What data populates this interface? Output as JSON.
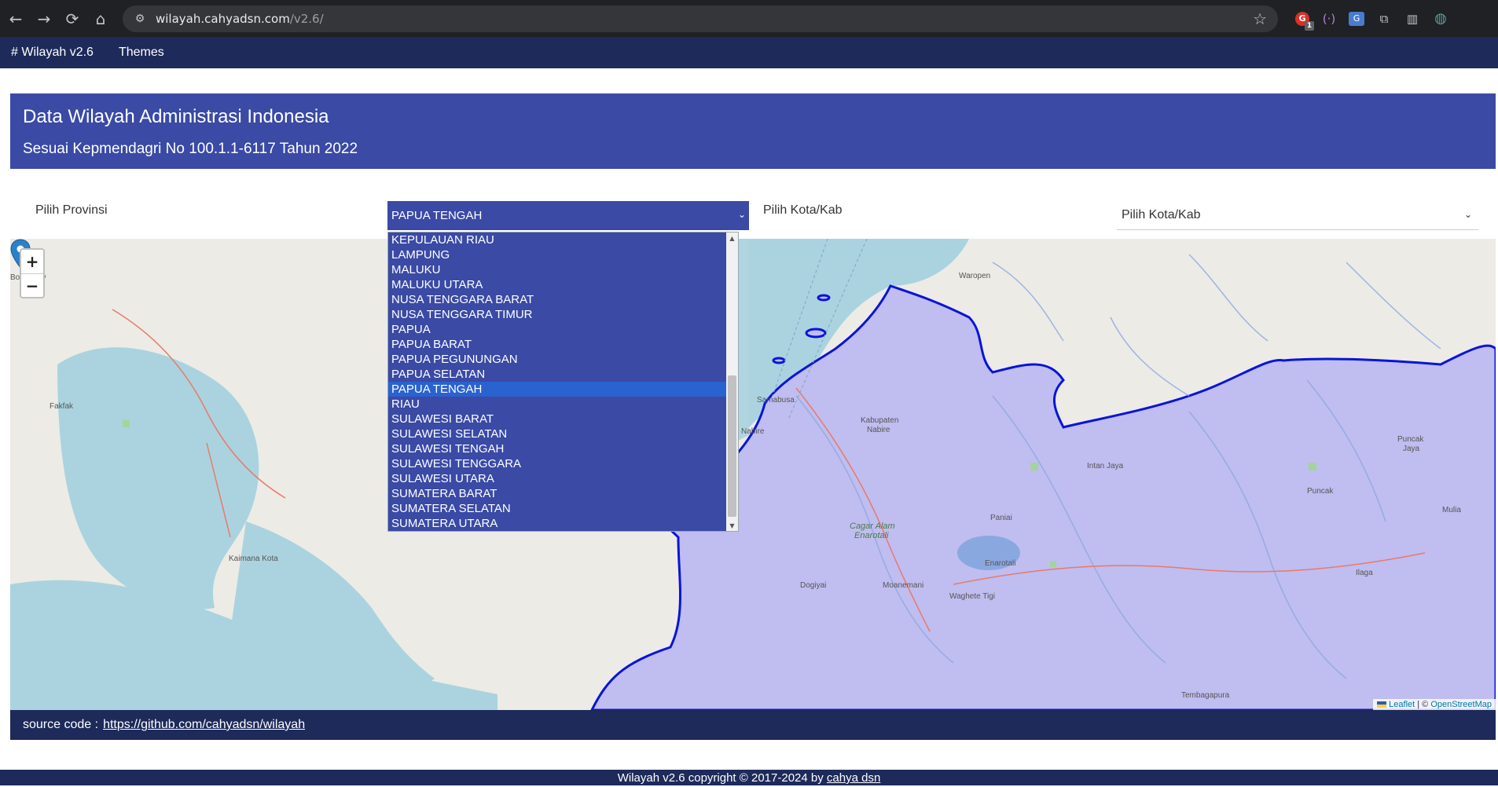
{
  "browser": {
    "url_host": "wilayah.cahyadsn.com",
    "url_path": "/v2.6/",
    "back_icon": "←",
    "forward_icon": "→",
    "reload_icon": "⟳",
    "home_icon": "⌂",
    "star_icon": "☆",
    "ext_badge": "1"
  },
  "navbar": {
    "brand": "# Wilayah v2.6",
    "themes": "Themes"
  },
  "header": {
    "title": "Data Wilayah Administrasi Indonesia",
    "subtitle": "Sesuai Kepmendagri No 100.1.1-6117 Tahun 2022"
  },
  "form": {
    "provinsi_label": "Pilih Provinsi",
    "provinsi_value": "PAPUA TENGAH",
    "kota_label": "Pilih Kota/Kab",
    "kota_value": "Pilih Kota/Kab"
  },
  "dropdown": {
    "options": [
      "KEPULAUAN RIAU",
      "LAMPUNG",
      "MALUKU",
      "MALUKU UTARA",
      "NUSA TENGGARA BARAT",
      "NUSA TENGGARA TIMUR",
      "PAPUA",
      "PAPUA BARAT",
      "PAPUA PEGUNUNGAN",
      "PAPUA SELATAN",
      "PAPUA TENGAH",
      "RIAU",
      "SULAWESI BARAT",
      "SULAWESI SELATAN",
      "SULAWESI TENGAH",
      "SULAWESI TENGGARA",
      "SULAWESI UTARA",
      "SUMATERA BARAT",
      "SUMATERA SELATAN",
      "SUMATERA UTARA"
    ],
    "selected_index": 10
  },
  "map": {
    "zoom_in": "+",
    "zoom_out": "−",
    "places": {
      "bomberay": "Bomberay",
      "fakfak": "Fakfak",
      "kaimana": "Kaimana Kota",
      "waropen": "Waropen",
      "samabusa": "Samabusa",
      "nabire": "Nabire",
      "kab_nabire_1": "Kabupaten",
      "kab_nabire_2": "Nabire",
      "intan_jaya": "Intan Jaya",
      "puncak_jaya_1": "Puncak",
      "puncak_jaya_2": "Jaya",
      "puncak": "Puncak",
      "mulia": "Mulia",
      "cagar_1": "Cagar Alam",
      "cagar_2": "Enarotali",
      "paniai": "Paniai",
      "enarotali": "Enarotali",
      "dogiyai": "Dogiyai",
      "moanemani": "Moanemani",
      "waghete": "Waghete Tigi",
      "ilaga": "Ilaga",
      "tembagapura": "Tembagapura"
    },
    "attribution_leaflet": "Leaflet",
    "attribution_sep": " | © ",
    "attribution_osm": "OpenStreetMap",
    "colors": {
      "land": "#ecebe6",
      "water": "#aad3df",
      "highlight_fill": "#c0bdf0",
      "highlight_stroke": "#0a14d8"
    }
  },
  "footer": {
    "source_label": "source code :",
    "source_link": "https://github.com/cahyadsn/wilayah",
    "copyright_prefix": "Wilayah v2.6 copyright © 2017-2024 by",
    "copyright_author": "cahya dsn"
  }
}
